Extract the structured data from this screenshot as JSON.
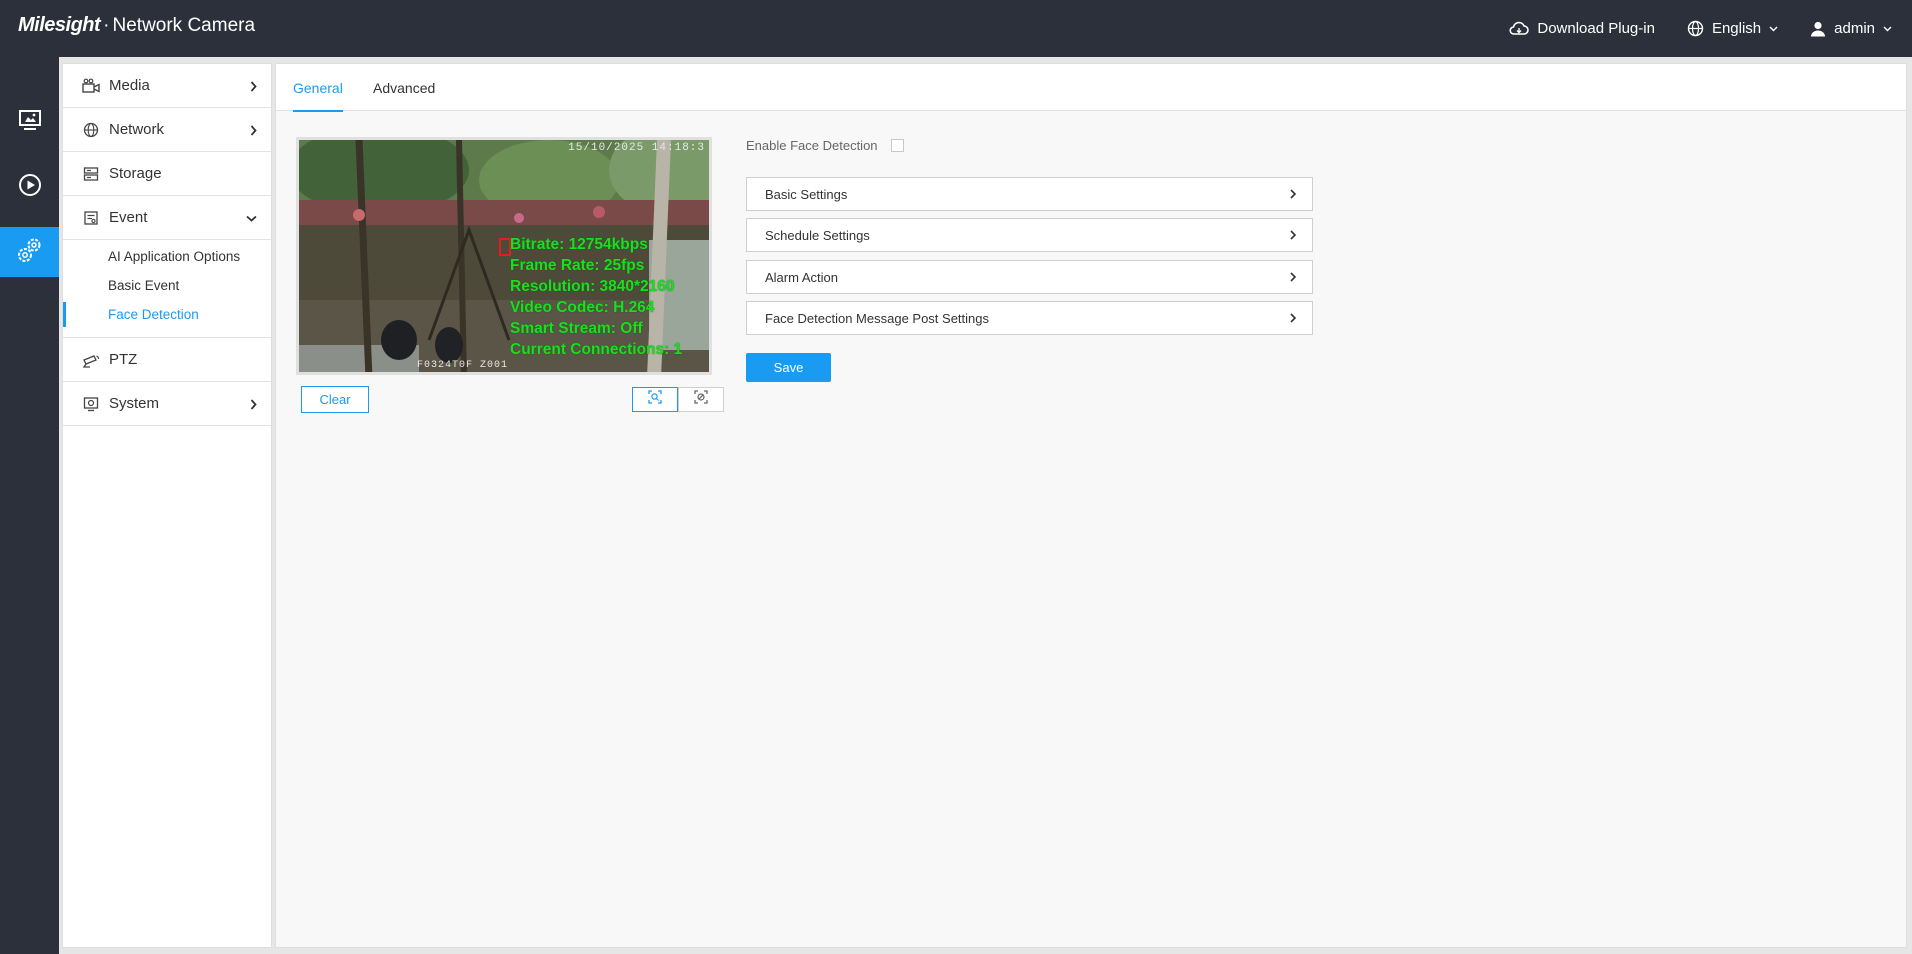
{
  "header": {
    "brand_logo": "Milesight",
    "brand_dot": "·",
    "brand_title": "Network Camera",
    "download_label": "Download Plug-in",
    "language_label": "English",
    "user_label": "admin"
  },
  "rail": {
    "items": [
      {
        "icon": "live-view-icon",
        "active": false
      },
      {
        "icon": "playback-icon",
        "active": false
      },
      {
        "icon": "settings-icon",
        "active": true
      }
    ]
  },
  "sidebar": {
    "items": [
      {
        "label": "Media",
        "icon": "camera-icon",
        "chevron": "right"
      },
      {
        "label": "Network",
        "icon": "globe-icon",
        "chevron": "right"
      },
      {
        "label": "Storage",
        "icon": "storage-icon",
        "chevron": "none"
      },
      {
        "label": "Event",
        "icon": "event-icon",
        "chevron": "down"
      },
      {
        "label": "PTZ",
        "icon": "ptz-icon",
        "chevron": "none"
      },
      {
        "label": "System",
        "icon": "system-icon",
        "chevron": "right"
      }
    ],
    "event_sub": [
      {
        "label": "AI Application Options",
        "active": false
      },
      {
        "label": "Basic Event",
        "active": false
      },
      {
        "label": "Face Detection",
        "active": true
      }
    ]
  },
  "tabs": [
    {
      "label": "General",
      "active": true
    },
    {
      "label": "Advanced",
      "active": false
    }
  ],
  "video": {
    "timestamp": "15/10/2025 14:18:3",
    "camera_name": "F0324T0F  Z001",
    "osd_lines": [
      "Bitrate: 12754kbps",
      "Frame Rate: 25fps",
      "Resolution: 3840*2160",
      "Video Codec: H.264",
      "Smart Stream: Off",
      "Current Connections: 1"
    ]
  },
  "controls": {
    "clear_label": "Clear"
  },
  "form": {
    "enable_label": "Enable Face Detection",
    "enable_checked": false,
    "panels": [
      "Basic Settings",
      "Schedule Settings",
      "Alarm Action",
      "Face Detection Message Post Settings"
    ],
    "save_label": "Save"
  },
  "colors": {
    "accent": "#1a9bf2",
    "header_bg": "#2b303a",
    "osd_text": "#19e01f"
  }
}
